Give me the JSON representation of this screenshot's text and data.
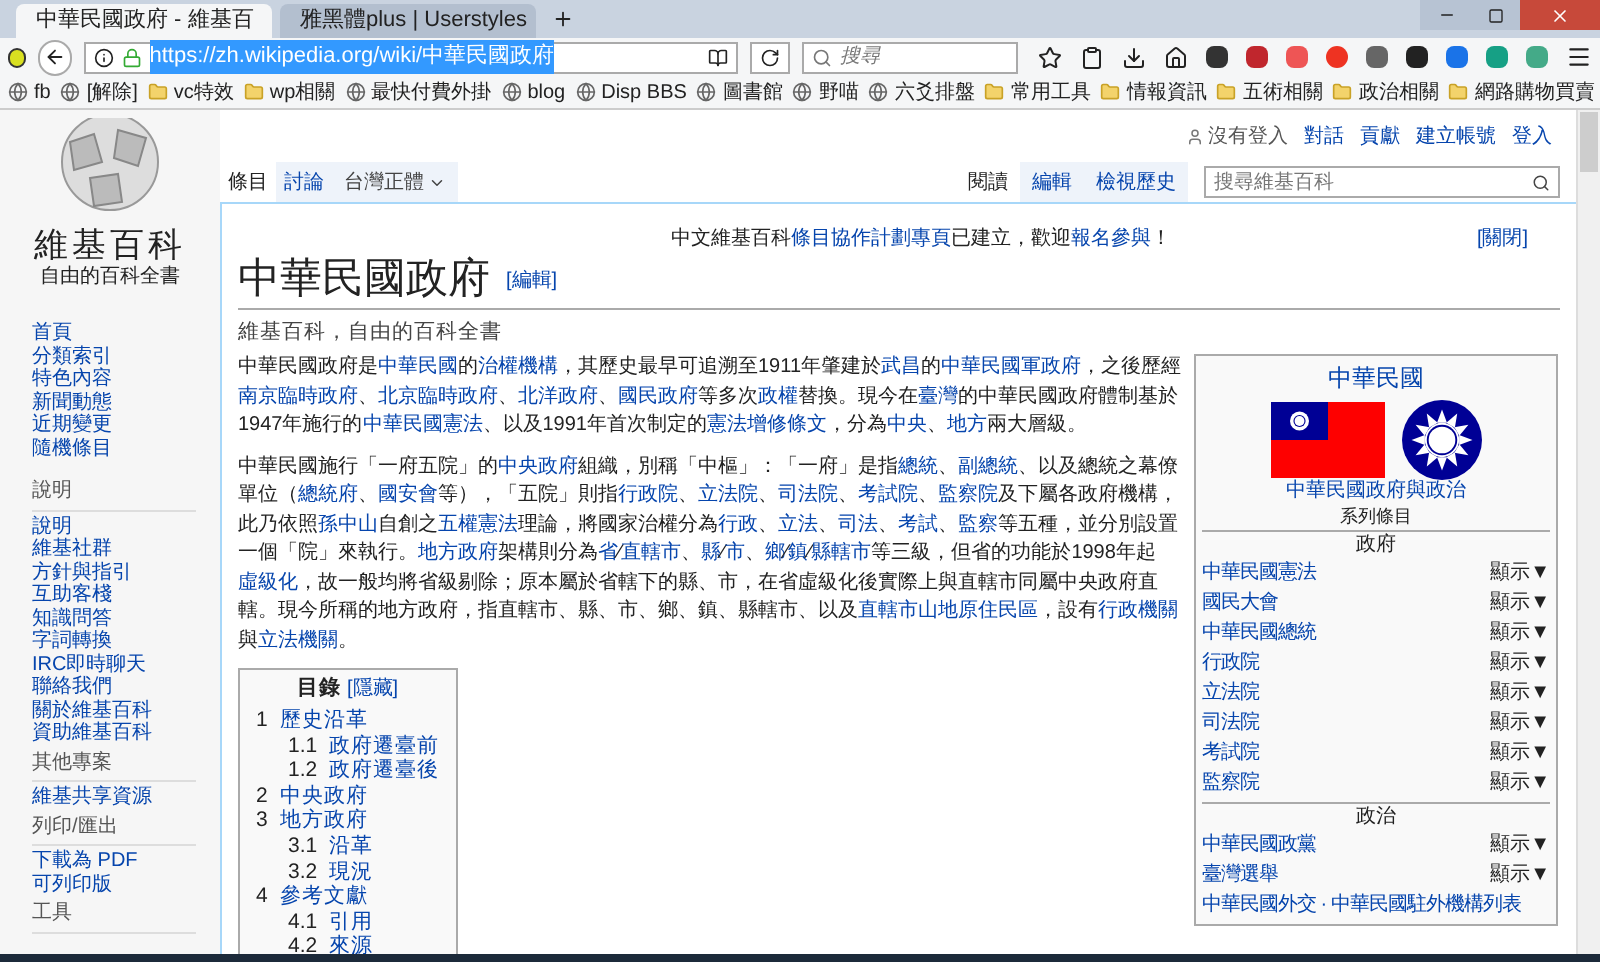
{
  "browser": {
    "tabs": [
      {
        "title": "中華民國政府 - 維基百",
        "selected": true
      },
      {
        "title": "雅黑體plus | Userstyles",
        "selected": false
      }
    ],
    "url": "https://zh.wikipedia.org/wiki/中華民國政府",
    "search_placeholder": "搜尋",
    "bookmarks": [
      {
        "label": "fb",
        "kind": "site"
      },
      {
        "label": "[解除]",
        "kind": "site"
      },
      {
        "label": "vc特效",
        "kind": "folder"
      },
      {
        "label": "wp相關",
        "kind": "folder"
      },
      {
        "label": "最快付費外掛",
        "kind": "site"
      },
      {
        "label": "blog",
        "kind": "site"
      },
      {
        "label": "Disp BBS",
        "kind": "site"
      },
      {
        "label": "圖書館",
        "kind": "site"
      },
      {
        "label": "野喵",
        "kind": "site"
      },
      {
        "label": "六爻排盤",
        "kind": "site"
      },
      {
        "label": "常用工具",
        "kind": "folder"
      },
      {
        "label": "情報資訊",
        "kind": "folder"
      },
      {
        "label": "五術相關",
        "kind": "folder"
      },
      {
        "label": "政治相關",
        "kind": "folder"
      },
      {
        "label": "網路購物買賣",
        "kind": "folder"
      }
    ]
  },
  "wiki": {
    "personal": {
      "status": "沒有登入",
      "links": [
        "對話",
        "貢獻",
        "建立帳號",
        "登入"
      ]
    },
    "left_tabs": [
      {
        "label": "條目",
        "selected": true
      },
      {
        "label": "討論",
        "selected": false
      }
    ],
    "variant": "台灣正體",
    "right_tabs": [
      {
        "label": "閱讀",
        "selected": true
      },
      {
        "label": "編輯",
        "selected": false
      },
      {
        "label": "檢視歷史",
        "selected": false
      }
    ],
    "search_placeholder": "搜尋維基百科",
    "logo": {
      "title": "維基百科",
      "subtitle": "自由的百科全書"
    },
    "sidebar": {
      "main": [
        "首頁",
        "分類索引",
        "特色內容",
        "新聞動態",
        "近期變更",
        "隨機條目"
      ],
      "sections": [
        {
          "heading": "說明",
          "items": [
            "說明",
            "維基社群",
            "方針與指引",
            "互助客棧",
            "知識問答",
            "字詞轉換",
            "IRC即時聊天",
            "聯絡我們",
            "關於維基百科",
            "資助維基百科"
          ]
        },
        {
          "heading": "其他專案",
          "items": [
            "維基共享資源"
          ]
        },
        {
          "heading": "列印/匯出",
          "items": [
            "下載為 PDF",
            "可列印版"
          ]
        },
        {
          "heading": "工具"
        }
      ]
    },
    "notice": [
      {
        "t": "中文維基百科",
        "link": false
      },
      {
        "t": "條目協作計劃專頁",
        "link": true
      },
      {
        "t": "已建立，歡迎",
        "link": false
      },
      {
        "t": "報名參與",
        "link": true
      },
      {
        "t": "！",
        "link": false
      }
    ],
    "notice_close": "[關閉]",
    "title": "中華民國政府",
    "edit": "[編輯]",
    "tagline": "維基百科，自由的百科全書",
    "paragraphs": [
      [
        {
          "t": "中華民國政府是",
          "link": false
        },
        {
          "t": "中華民國",
          "link": true
        },
        {
          "t": "的",
          "link": false
        },
        {
          "t": "治權機構",
          "link": true
        },
        {
          "t": "，其歷史最早可追溯至1911年肇建於",
          "link": false
        },
        {
          "t": "武昌",
          "link": true
        },
        {
          "t": "的",
          "link": false
        },
        {
          "t": "中華民國軍政府",
          "link": true
        },
        {
          "t": "，之後歷經",
          "link": false
        },
        {
          "t": "南京臨時政府",
          "link": true
        },
        {
          "t": "、",
          "link": false
        },
        {
          "t": "北京臨時政府",
          "link": true
        },
        {
          "t": "、",
          "link": false
        },
        {
          "t": "北洋政府",
          "link": true
        },
        {
          "t": "、",
          "link": false
        },
        {
          "t": "國民政府",
          "link": true
        },
        {
          "t": "等多次",
          "link": false
        },
        {
          "t": "政權",
          "link": true
        },
        {
          "t": "替換。現今在",
          "link": false
        },
        {
          "t": "臺灣",
          "link": true
        },
        {
          "t": "的中華民國政府體制基於1947年施行的",
          "link": false
        },
        {
          "t": "中華民國憲法",
          "link": true
        },
        {
          "t": "、以及1991年首次制定的",
          "link": false
        },
        {
          "t": "憲法增修條文",
          "link": true
        },
        {
          "t": "，分為",
          "link": false
        },
        {
          "t": "中央",
          "link": true
        },
        {
          "t": "、",
          "link": false
        },
        {
          "t": "地方",
          "link": true
        },
        {
          "t": "兩大層級。",
          "link": false
        }
      ],
      [
        {
          "t": "中華民國施行「一府五院」的",
          "link": false
        },
        {
          "t": "中央政府",
          "link": true
        },
        {
          "t": "組織，別稱「中樞」：「一府」是指",
          "link": false
        },
        {
          "t": "總統",
          "link": true
        },
        {
          "t": "、",
          "link": false
        },
        {
          "t": "副總統",
          "link": true
        },
        {
          "t": "、以及總統之幕僚單位（",
          "link": false
        },
        {
          "t": "總統府",
          "link": true
        },
        {
          "t": "、",
          "link": false
        },
        {
          "t": "國安會",
          "link": true
        },
        {
          "t": "等），「五院」則指",
          "link": false
        },
        {
          "t": "行政院",
          "link": true
        },
        {
          "t": "、",
          "link": false
        },
        {
          "t": "立法院",
          "link": true
        },
        {
          "t": "、",
          "link": false
        },
        {
          "t": "司法院",
          "link": true
        },
        {
          "t": "、",
          "link": false
        },
        {
          "t": "考試院",
          "link": true
        },
        {
          "t": "、",
          "link": false
        },
        {
          "t": "監察院",
          "link": true
        },
        {
          "t": "及下屬各政府機構，此乃依照",
          "link": false
        },
        {
          "t": "孫中山",
          "link": true
        },
        {
          "t": "自創之",
          "link": false
        },
        {
          "t": "五權憲法",
          "link": true
        },
        {
          "t": "理論，將國家治權分為",
          "link": false
        },
        {
          "t": "行政",
          "link": true
        },
        {
          "t": "、",
          "link": false
        },
        {
          "t": "立法",
          "link": true
        },
        {
          "t": "、",
          "link": false
        },
        {
          "t": "司法",
          "link": true
        },
        {
          "t": "、",
          "link": false
        },
        {
          "t": "考試",
          "link": true
        },
        {
          "t": "、",
          "link": false
        },
        {
          "t": "監察",
          "link": true
        },
        {
          "t": "等五種，並分別設置一個「院」來執行。",
          "link": false
        },
        {
          "t": "地方政府",
          "link": true
        },
        {
          "t": "架構則分為",
          "link": false
        },
        {
          "t": "省",
          "link": true
        },
        {
          "t": "∕",
          "link": false
        },
        {
          "t": "直轄市",
          "link": true
        },
        {
          "t": "、",
          "link": false
        },
        {
          "t": "縣",
          "link": true
        },
        {
          "t": "∕",
          "link": false
        },
        {
          "t": "市",
          "link": true
        },
        {
          "t": "、",
          "link": false
        },
        {
          "t": "鄉",
          "link": true
        },
        {
          "t": "∕",
          "link": false
        },
        {
          "t": "鎮",
          "link": true
        },
        {
          "t": "∕",
          "link": false
        },
        {
          "t": "縣轄市",
          "link": true
        },
        {
          "t": "等三級，但省的功能於1998年起",
          "link": false
        },
        {
          "t": "虛級化",
          "link": true
        },
        {
          "t": "，故一般均將省級剔除；原本屬於省轄下的縣、市，在省虛級化後實際上與直轄市同屬中央政府直轄。現今所稱的地方政府，指直轄市、縣、市、鄉、鎮、縣轄市、以及",
          "link": false
        },
        {
          "t": "直轄市山地原住民區",
          "link": true
        },
        {
          "t": "，設有",
          "link": false
        },
        {
          "t": "行政機關",
          "link": true
        },
        {
          "t": "與",
          "link": false
        },
        {
          "t": "立法機關",
          "link": true
        },
        {
          "t": "。",
          "link": false
        }
      ]
    ],
    "toc": {
      "title": "目錄",
      "toggle": "[隱藏]",
      "items": [
        {
          "number": "1",
          "label": "歷史沿革",
          "children": [
            {
              "number": "1.1",
              "label": "政府遷臺前"
            },
            {
              "number": "1.2",
              "label": "政府遷臺後"
            }
          ]
        },
        {
          "number": "2",
          "label": "中央政府"
        },
        {
          "number": "3",
          "label": "地方政府",
          "children": [
            {
              "number": "3.1",
              "label": "沿革"
            },
            {
              "number": "3.2",
              "label": "現況"
            }
          ]
        },
        {
          "number": "4",
          "label": "參考文獻",
          "children": [
            {
              "number": "4.1",
              "label": "引用"
            },
            {
              "number": "4.2",
              "label": "來源"
            }
          ]
        }
      ]
    },
    "infobox": {
      "title": "中華民國",
      "caption": "中華民國政府與政治",
      "series": "系列條目",
      "sections": [
        {
          "heading": "政府",
          "rows": [
            {
              "label": "中華民國憲法",
              "toggle": "顯示▼"
            },
            {
              "label": "國民大會",
              "toggle": "顯示▼"
            },
            {
              "label": "中華民國總統",
              "toggle": "顯示▼"
            },
            {
              "label": "行政院",
              "toggle": "顯示▼"
            },
            {
              "label": "立法院",
              "toggle": "顯示▼"
            },
            {
              "label": "司法院",
              "toggle": "顯示▼"
            },
            {
              "label": "考試院",
              "toggle": "顯示▼"
            },
            {
              "label": "監察院",
              "toggle": "顯示▼"
            }
          ]
        },
        {
          "heading": "政治",
          "rows": [
            {
              "label": "中華民國政黨",
              "toggle": "顯示▼"
            },
            {
              "label": "臺灣選舉",
              "toggle": "顯示▼"
            },
            {
              "label": "中華民國外交 · 中華民國駐外機構列表"
            }
          ]
        }
      ]
    }
  }
}
